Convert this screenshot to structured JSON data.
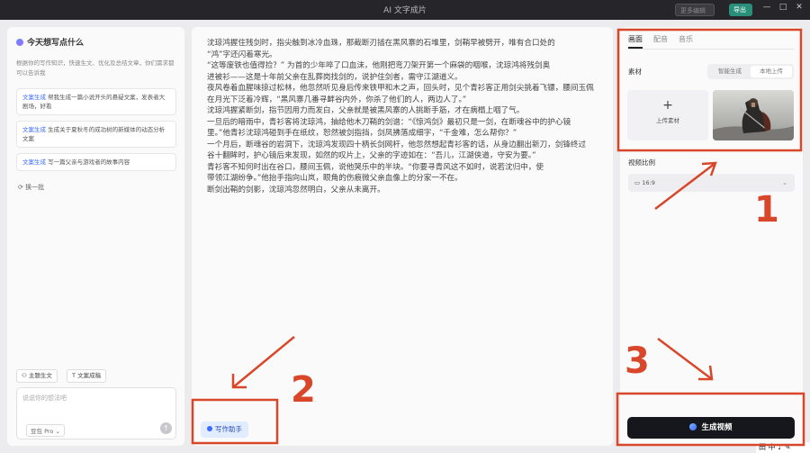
{
  "window": {
    "title": "AI 文字成片",
    "more_edit_label": "更多编辑",
    "export_label": "导出",
    "minimize": "—",
    "maximize": "□",
    "close": "✕"
  },
  "left": {
    "heading": "今天想写点什么",
    "description": "根据你的写作知识，快速生文、优化及总结文章，你们需求都可以告诉我",
    "suggestions": [
      {
        "tag": "文案生成",
        "text": "帮我生成一篇小说开头的悬疑文案，发表者大剧场，好看"
      },
      {
        "tag": "文案生成",
        "text": "生成关于夏秋冬的成功树的新媒体的动态分析文案"
      },
      {
        "tag": "文案生成",
        "text": "写一篇父亲与游戏者的故事内容"
      }
    ],
    "refresh_label": "换一批",
    "chip_theme": "主题生文",
    "chip_text": "文案成稿",
    "prompt_placeholder": "说说你的想法吧",
    "model": "豆包 Pro",
    "send_icon": "↑"
  },
  "editor": {
    "paragraphs": [
      "沈琼鸿握住残剑时，指尖触到冰冷血珠，那截断刃插在黑风寨的石堆里，剑鞘早被劈开，唯有合口处的",
      "“鸿”字还闪着寒光。",
      "“这等废铁也值得捡？” 为首的少年啐了口血沫，他刚把弯刀架开第一个麻袋的咽喉，沈琼鸿将残剑奥",
      "进被衫——这是十年前父亲在乱葬岗找剑的，说护住剑者，需守江湖道义。",
      "夜风卷着血腥味掠过松林，他忽然听见身后传来铁甲和木之声，回头时，见个青衫客正用剑尖挑着飞镖，腰间玉佩",
      "在月光下泛着冷辉，“黑风寨几番寻衅谷内外，你杀了他们的人，两边人了。”",
      "沈琼鸿握紧断剑，指节因用力而发白，父亲就是被黑风寨的人挑断手筋，才在病榻上咽了气。",
      "一旦后的暗雨中，青衫客将沈琼鸿，抽给他木刀鞘的剑谱：“《惊鸿剑》最初只是一剑，在断魂谷中的护心镜",
      "里。”他青衫沈琼鸿碰到手在纸纹，恕然被剑指挡，剑凤拂落成细字，“千金难，怎么帮你？”",
      "一个月后，断魂谷的岩洞下，沈琼鸿发现四十柄长剑网杆，他忽然想起青衫客的话，从身边翻出新刀，剑锋终过",
      "谷十翻眸时，护心镜后来发现，如然的叹片上，父亲的字迹如在：“吾儿，江湖侠道，守安为要。”",
      "青衫客不知何时出在谷口，腰间玉佩，说他哭乐中的半块。“你要寻青风这不如时，说若沈归中，使",
      "带领江湖纷争。”他抬手指向山岚，眼角的伤痕微父亲血像上的分家一不在。",
      "断剑出鞘的剑影，沈琼鸿忽然明白，父亲从未离开。"
    ],
    "assist_label": "写作助手"
  },
  "right": {
    "tabs": [
      "画面",
      "配音",
      "音乐"
    ],
    "active_tab": 0,
    "material_label": "素材",
    "seg_smart": "智能生成",
    "seg_local": "本地上传",
    "upload_plus": "+",
    "upload_label": "上传素材",
    "ratio_label": "视频比例",
    "ratio_value": "16:9",
    "generate_label": "生成视频"
  },
  "taskbar": {
    "ime": "田 中 ♪ ✎"
  },
  "annotations": {
    "n1": "1",
    "n2": "2",
    "n3": "3",
    "color": "#d9472b"
  }
}
